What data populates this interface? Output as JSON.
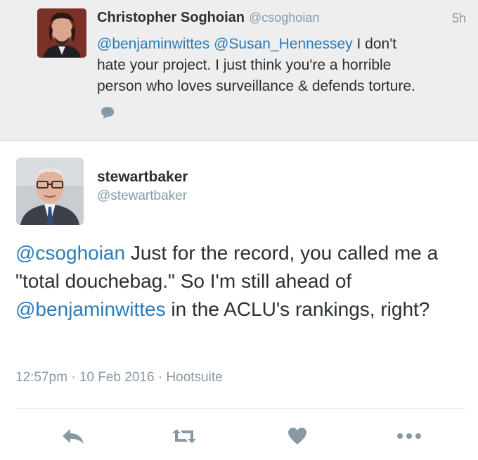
{
  "reply_tweet": {
    "author_name": "Christopher Soghoian",
    "author_handle": "@csoghoian",
    "time": "5h",
    "mentions": [
      "@benjaminwittes",
      "@Susan_Hennessey"
    ],
    "text_1": "I don't",
    "text_2": "hate your project. I just think you're a horrible",
    "text_3": "person who loves surveillance & defends torture."
  },
  "main_tweet": {
    "author_name": "stewartbaker",
    "author_handle": "@stewartbaker",
    "mention_1": "@csoghoian",
    "text_1": " Just for the record, you called me a \"total douchebag.\" So I'm still ahead of ",
    "mention_2": "@benjaminwittes",
    "text_2": " in the ACLU's rankings, right?",
    "timestamp": "12:57pm · 10 Feb 2016 · Hootsuite"
  },
  "actions": {
    "icons": [
      "reply-icon",
      "retweet-icon",
      "like-icon",
      "more-icon"
    ]
  },
  "colors": {
    "link": "#2b7bb9",
    "muted": "#8899a6",
    "text": "#292f33",
    "reply_bg": "#eeeeee"
  }
}
